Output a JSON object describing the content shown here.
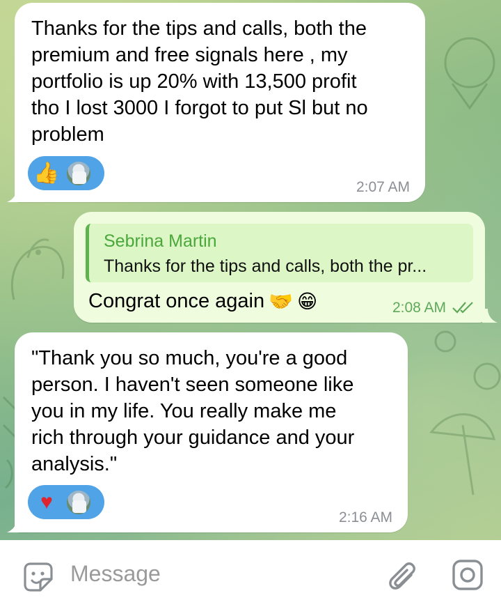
{
  "chat": {
    "messages": [
      {
        "direction": "incoming",
        "text": "Thanks for the tips and calls, both the\npremium and free signals here , my\nportfolio is up 20% with 13,500 profit\ntho I lost 3000 I forgot to put Sl but no\nproblem",
        "time": "2:07 AM",
        "reaction_emoji": "👍",
        "reaction_icon": "thumbs-up-icon"
      },
      {
        "direction": "outgoing",
        "reply_to_name": "Sebrina Martin",
        "reply_to_text": "Thanks for the tips and calls, both the pr...",
        "text": "Congrat once again",
        "emojis": [
          "🤝",
          "😁"
        ],
        "time": "2:08 AM",
        "status": "read",
        "status_icon": "double-check-icon"
      },
      {
        "direction": "incoming",
        "text": "\"Thank you so much, you're a good\nperson. I haven't seen someone like\nyou in my life. You really make me\nrich through your guidance and your\nanalysis.\"",
        "time": "2:16 AM",
        "reaction_emoji": "♥",
        "reaction_icon": "heart-icon"
      }
    ]
  },
  "composer": {
    "placeholder": "Message",
    "left_icon": "sticker-icon",
    "attach_icon": "paperclip-icon",
    "camera_icon": "camera-icon"
  },
  "colors": {
    "incoming_bubble": "#ffffff",
    "outgoing_bubble": "#effdde",
    "reply_accent": "#5fb34e",
    "reaction_pill": "#4fa3e6",
    "time_outgoing": "#5fa85a"
  }
}
